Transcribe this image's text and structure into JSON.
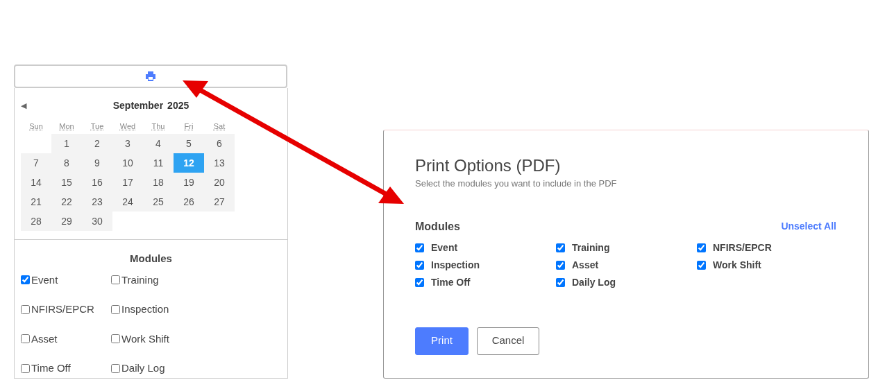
{
  "calendar": {
    "month": "September",
    "year": "2025",
    "prev_button": "◀",
    "weekdays": [
      "Sun",
      "Mon",
      "Tue",
      "Wed",
      "Thu",
      "Fri",
      "Sat"
    ],
    "weeks": [
      [
        {
          "kind": "blank"
        },
        {
          "label": "1",
          "selected": false
        },
        {
          "label": "2",
          "selected": false
        },
        {
          "label": "3",
          "selected": false
        },
        {
          "label": "4",
          "selected": false
        },
        {
          "label": "5",
          "selected": false
        },
        {
          "label": "6",
          "selected": false
        }
      ],
      [
        {
          "label": "7",
          "selected": false
        },
        {
          "label": "8",
          "selected": false
        },
        {
          "label": "9",
          "selected": false
        },
        {
          "label": "10",
          "selected": false
        },
        {
          "label": "11",
          "selected": false
        },
        {
          "label": "12",
          "selected": true
        },
        {
          "label": "13",
          "selected": false
        }
      ],
      [
        {
          "label": "14",
          "selected": false
        },
        {
          "label": "15",
          "selected": false
        },
        {
          "label": "16",
          "selected": false
        },
        {
          "label": "17",
          "selected": false
        },
        {
          "label": "18",
          "selected": false
        },
        {
          "label": "19",
          "selected": false
        },
        {
          "label": "20",
          "selected": false
        }
      ],
      [
        {
          "label": "21",
          "selected": false
        },
        {
          "label": "22",
          "selected": false
        },
        {
          "label": "23",
          "selected": false
        },
        {
          "label": "24",
          "selected": false
        },
        {
          "label": "25",
          "selected": false
        },
        {
          "label": "26",
          "selected": false
        },
        {
          "label": "27",
          "selected": false
        }
      ],
      [
        {
          "label": "28",
          "selected": false
        },
        {
          "label": "29",
          "selected": false
        },
        {
          "label": "30",
          "selected": false
        }
      ]
    ]
  },
  "side_modules": {
    "title": "Modules",
    "items": [
      {
        "label": "Event",
        "checked": true
      },
      {
        "label": "Training",
        "checked": false
      },
      {
        "label": "NFIRS/EPCR",
        "checked": false
      },
      {
        "label": "Inspection",
        "checked": false
      },
      {
        "label": "Asset",
        "checked": false
      },
      {
        "label": "Work Shift",
        "checked": false
      },
      {
        "label": "Time Off",
        "checked": false
      },
      {
        "label": "Daily Log",
        "checked": false
      }
    ]
  },
  "dialog": {
    "title": "Print Options (PDF)",
    "subtitle": "Select the modules you want to include in the PDF",
    "modules_title": "Modules",
    "unselect_all": "Unselect All",
    "items": [
      {
        "label": "Event",
        "checked": true
      },
      {
        "label": "Training",
        "checked": true
      },
      {
        "label": "NFIRS/EPCR",
        "checked": true
      },
      {
        "label": "Inspection",
        "checked": true
      },
      {
        "label": "Asset",
        "checked": true
      },
      {
        "label": "Work Shift",
        "checked": true
      },
      {
        "label": "Time Off",
        "checked": true
      },
      {
        "label": "Daily Log",
        "checked": true
      }
    ],
    "buttons": [
      {
        "label": "Print",
        "kind": "primary"
      },
      {
        "label": "Cancel",
        "kind": "secondary"
      }
    ]
  }
}
